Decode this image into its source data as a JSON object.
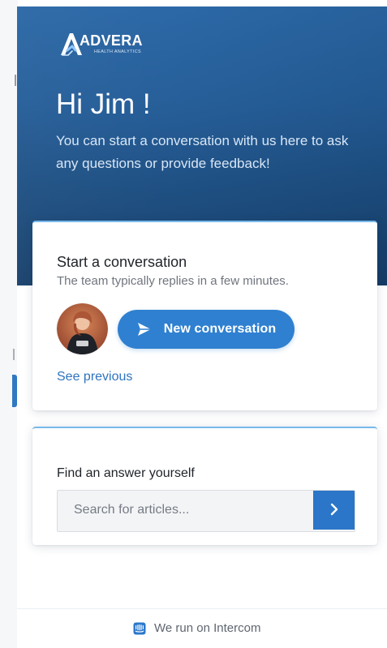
{
  "brand": {
    "name": "ADVERA",
    "tagline": "HEALTH ANALYTICS"
  },
  "hero": {
    "greeting": "Hi Jim !",
    "intro": "You can start a conversation with us here to ask any questions or provide feedback!"
  },
  "conversation": {
    "title": "Start a conversation",
    "subtitle": "The team typically replies in a few minutes.",
    "new_button_label": "New conversation",
    "see_previous_label": "See previous",
    "avatar_icon": "team-avatar",
    "send_icon": "send-icon"
  },
  "help": {
    "title": "Find an answer yourself",
    "search_placeholder": "Search for articles...",
    "search_button_icon": "chevron-right-icon"
  },
  "footer": {
    "text": "We run on Intercom",
    "icon": "intercom-icon"
  },
  "colors": {
    "hero_top": "#2a67a6",
    "hero_bottom": "#163f69",
    "accent": "#2f80d0",
    "link": "#2f74bf",
    "search_button": "#2b76c8"
  }
}
